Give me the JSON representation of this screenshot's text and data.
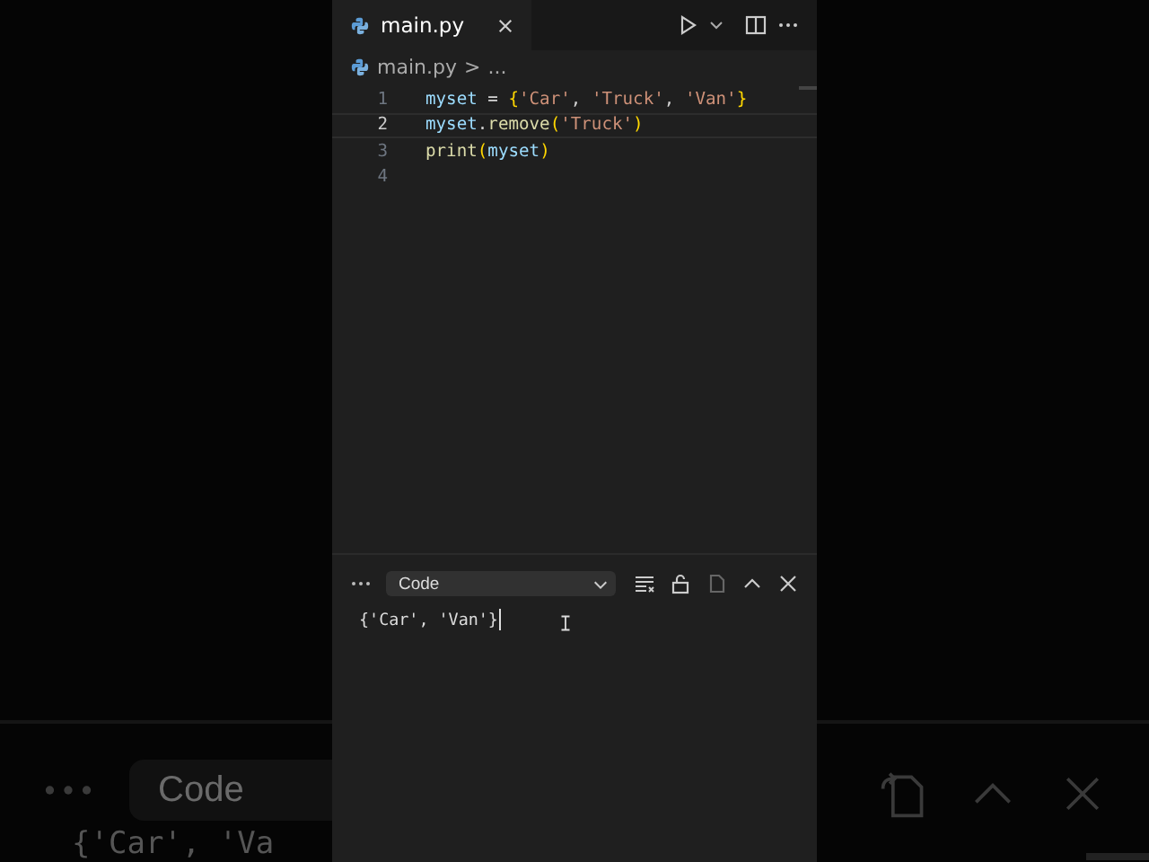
{
  "backdrop": {
    "dropdown": "Code",
    "output": "{'Car', 'Va"
  },
  "tab": {
    "label": "main.py",
    "selected": true
  },
  "breadcrumb": {
    "file": "main.py",
    "separator": ">",
    "rest": "..."
  },
  "editor": {
    "lines": [
      {
        "number": "1",
        "current": false,
        "tokens": [
          {
            "text": "myset",
            "kind": "var"
          },
          {
            "text": " = ",
            "kind": "op"
          },
          {
            "text": "{",
            "kind": "brace"
          },
          {
            "text": "'Car'",
            "kind": "str"
          },
          {
            "text": ", ",
            "kind": "op"
          },
          {
            "text": "'Truck'",
            "kind": "str"
          },
          {
            "text": ", ",
            "kind": "op"
          },
          {
            "text": "'Van'",
            "kind": "str"
          },
          {
            "text": "}",
            "kind": "brace"
          }
        ]
      },
      {
        "number": "2",
        "current": true,
        "tokens": [
          {
            "text": "myset",
            "kind": "var"
          },
          {
            "text": ".",
            "kind": "op"
          },
          {
            "text": "remove",
            "kind": "func"
          },
          {
            "text": "(",
            "kind": "brace"
          },
          {
            "text": "'Truck'",
            "kind": "str"
          },
          {
            "text": ")",
            "kind": "brace"
          }
        ]
      },
      {
        "number": "3",
        "current": false,
        "tokens": [
          {
            "text": "print",
            "kind": "func"
          },
          {
            "text": "(",
            "kind": "brace"
          },
          {
            "text": "myset",
            "kind": "var"
          },
          {
            "text": ")",
            "kind": "brace"
          }
        ]
      },
      {
        "number": "4",
        "current": false
      }
    ]
  },
  "panel": {
    "dropdown": "Code",
    "output": "{'Car', 'Van'}"
  }
}
